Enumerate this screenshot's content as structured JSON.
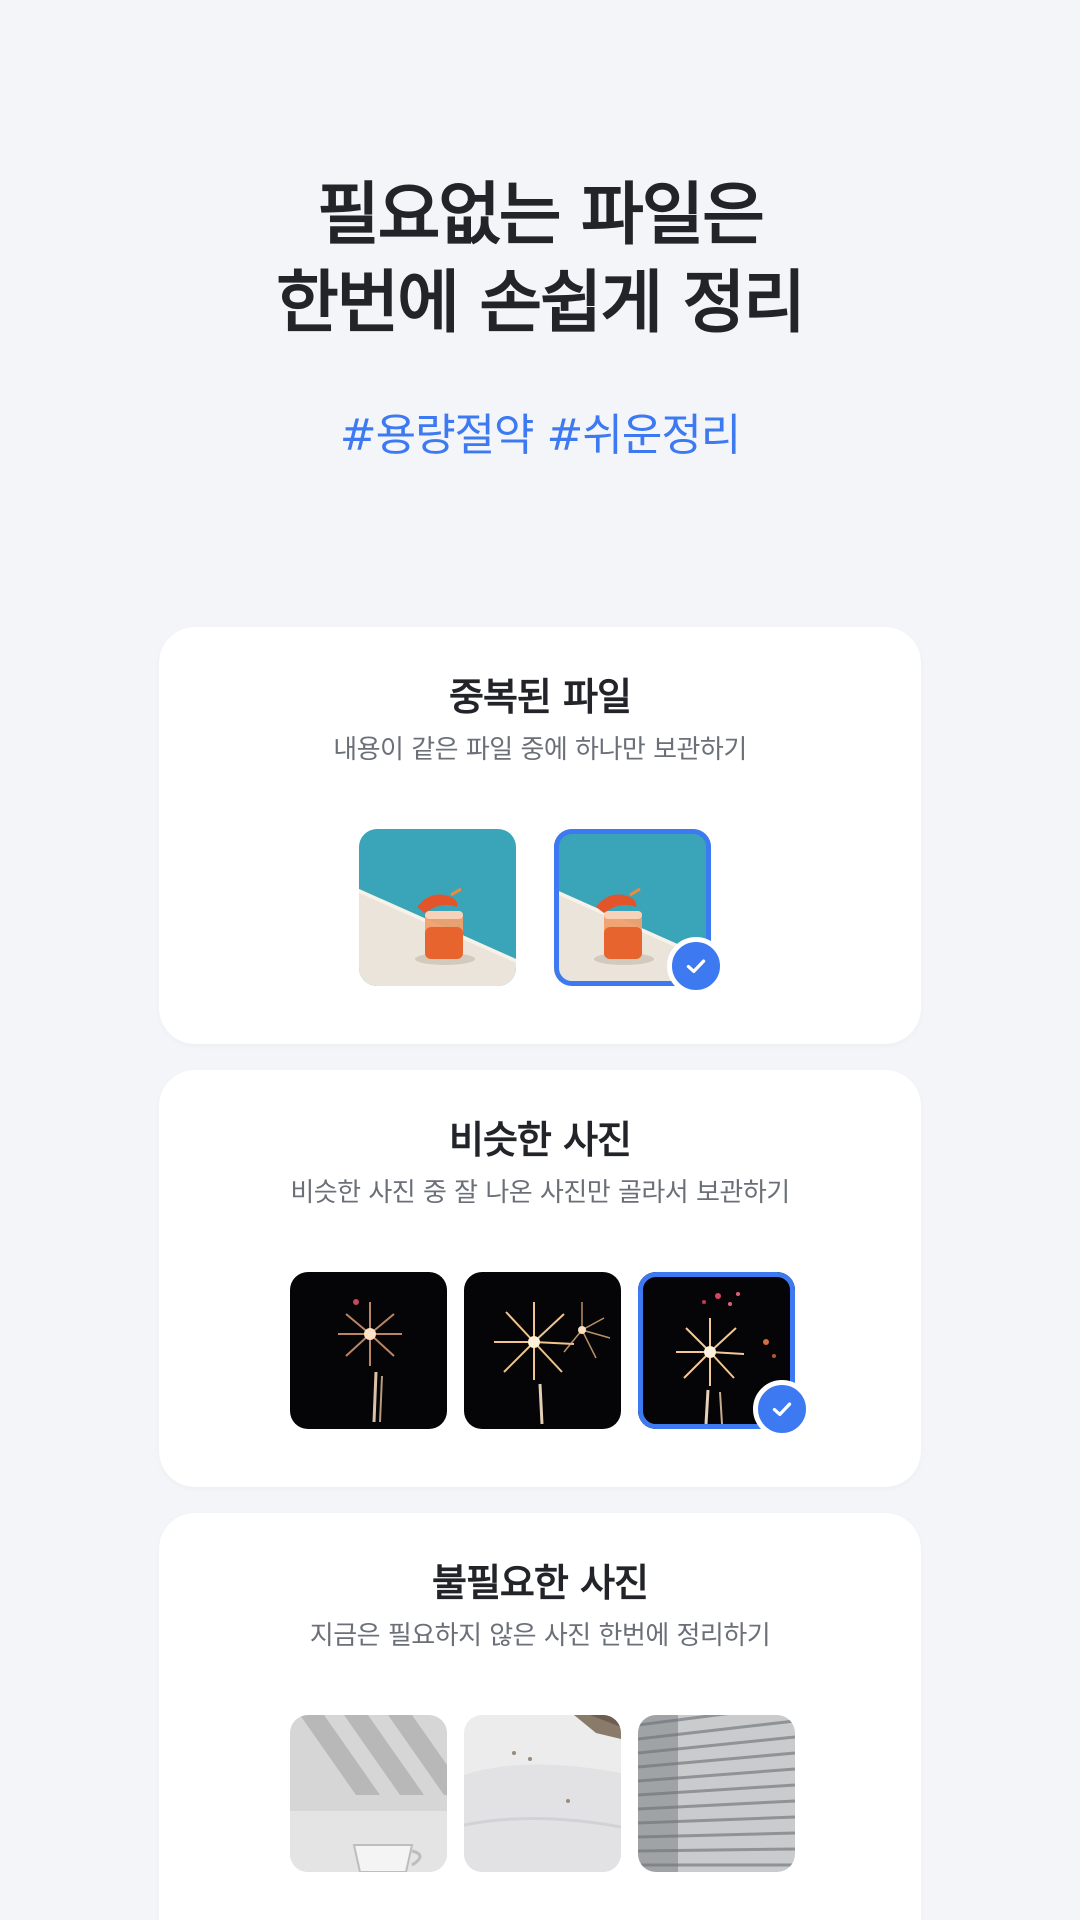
{
  "hero": {
    "headline_line1": "필요없는 파일은",
    "headline_line2": "한번에 손쉽게 정리",
    "hashtags": "#용량절약 #쉬운정리"
  },
  "cards": [
    {
      "title": "중복된 파일",
      "subtitle": "내용이 같은 파일 중에 하나만 보관하기",
      "thumbnails": [
        "drink-photo",
        "drink-photo"
      ],
      "selected_index": 1
    },
    {
      "title": "비슷한 사진",
      "subtitle": "비슷한 사진 중 잘 나온 사진만 골라서 보관하기",
      "thumbnails": [
        "fireworks-photo",
        "fireworks-photo",
        "fireworks-photo"
      ],
      "selected_index": 2
    },
    {
      "title": "불필요한 사진",
      "subtitle": "지금은 필요하지 않은 사진 한번에 정리하기",
      "thumbnails": [
        "shadow-cup-photo",
        "snow-slope-photo",
        "building-facade-photo"
      ]
    }
  ],
  "colors": {
    "background": "#f4f5f9",
    "accent": "#3d7af2",
    "card": "#ffffff",
    "title_text": "#222429",
    "subtitle_text": "#6b6f78"
  },
  "icons": {
    "selected_badge": "check-icon"
  }
}
